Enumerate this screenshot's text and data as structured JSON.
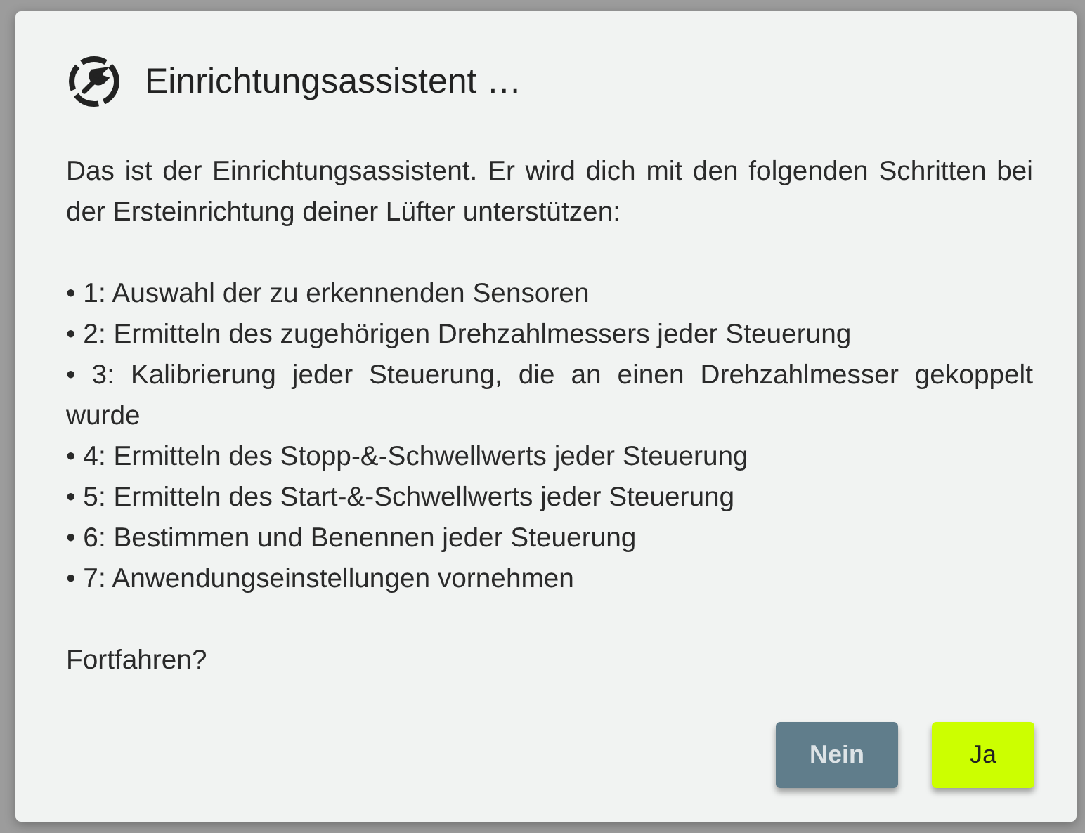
{
  "dialog": {
    "title": "Einrichtungsassistent …",
    "intro": "Das ist der Einrichtungsassistent. Er wird dich mit den folgenden Schritten bei der Ersteinrichtung deiner Lüfter unterstützen:",
    "steps": [
      "• 1: Auswahl der zu erkennenden Sensoren",
      "• 2: Ermitteln des zugehörigen Drehzahlmessers jeder Steuerung",
      "• 3: Kalibrierung jeder Steuerung, die an einen Drehzahlmesser gekoppelt wurde",
      "• 4: Ermitteln des Stopp-&-Schwellwerts jeder Steuerung",
      "• 5: Ermitteln des Start-&-Schwellwerts jeder Steuerung",
      "• 6: Bestimmen und Benennen jeder Steuerung",
      "• 7: Anwendungseinstellungen vornehmen"
    ],
    "question": "Fortfahren?",
    "buttons": [
      {
        "label": "Nein",
        "kind": "secondary"
      },
      {
        "label": "Ja",
        "kind": "primary"
      }
    ]
  }
}
